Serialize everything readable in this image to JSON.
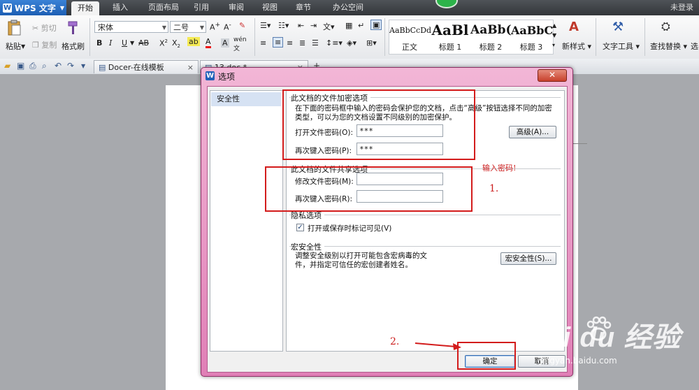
{
  "app": {
    "logo": "WPS 文字",
    "logo_letter": "W",
    "tabs": [
      "开始",
      "插入",
      "页面布局",
      "引用",
      "审阅",
      "视图",
      "章节",
      "办公空间"
    ],
    "login": "未登录"
  },
  "ribbon": {
    "paste": "粘贴",
    "cut": "剪切",
    "copy": "复制",
    "format_painter": "格式刷",
    "font_name": "宋体",
    "font_size": "二号",
    "styles": [
      {
        "preview": "AaBbCcDd",
        "label": "正文"
      },
      {
        "preview": "AaBl",
        "label": "标题 1"
      },
      {
        "preview": "AaBb(",
        "label": "标题 2"
      },
      {
        "preview": "AaBbC",
        "label": "标题 3"
      }
    ],
    "new_style": "新样式",
    "text_tools": "文字工具",
    "find_replace": "查找替换",
    "select": "选"
  },
  "doc_tabs": [
    {
      "label": "Docer-在线模板"
    },
    {
      "label": "13.doc *"
    }
  ],
  "dialog": {
    "title": "选项",
    "close": "✕",
    "category": "安全性",
    "encrypt": {
      "title": "此文档的文件加密选项",
      "desc_line1": "在下面的密码框中输入的密码会保护您的文档，点击“高级”按钮选择不同的加密",
      "desc_line2": "类型，可以为您的文档设置不同级别的加密保护。",
      "open_password_label": "打开文件密码(O):",
      "open_password_value": "***",
      "confirm_label": "再次键入密码(P):",
      "confirm_value": "***",
      "advanced_button": "高级(A)..."
    },
    "share": {
      "title": "此文档的文件共享选项",
      "modify_label": "修改文件密码(M):",
      "modify_value": "",
      "confirm_label": "再次键入密码(R):",
      "confirm_value": ""
    },
    "privacy": {
      "title": "隐私选项",
      "checkbox_label": "打开或保存时标记可见(V)",
      "checked": true
    },
    "macro": {
      "title": "宏安全性",
      "desc_line1": "调整安全级别以打开可能包含宏病毒的文",
      "desc_line2": "件，并指定可信任的宏创建者姓名。",
      "button": "宏安全性(S)..."
    },
    "ok": "确定",
    "cancel": "取消"
  },
  "annotations": {
    "hint": "输入密码!",
    "step1": "1.",
    "step2": "2."
  },
  "watermark": {
    "brand": "Bai du 经验",
    "url": "jingyan.baidu.com"
  },
  "colors": {
    "annotation_red": "#d31c1c",
    "dialog_frame": "#e07fb6",
    "wps_blue": "#1d5fb4"
  }
}
